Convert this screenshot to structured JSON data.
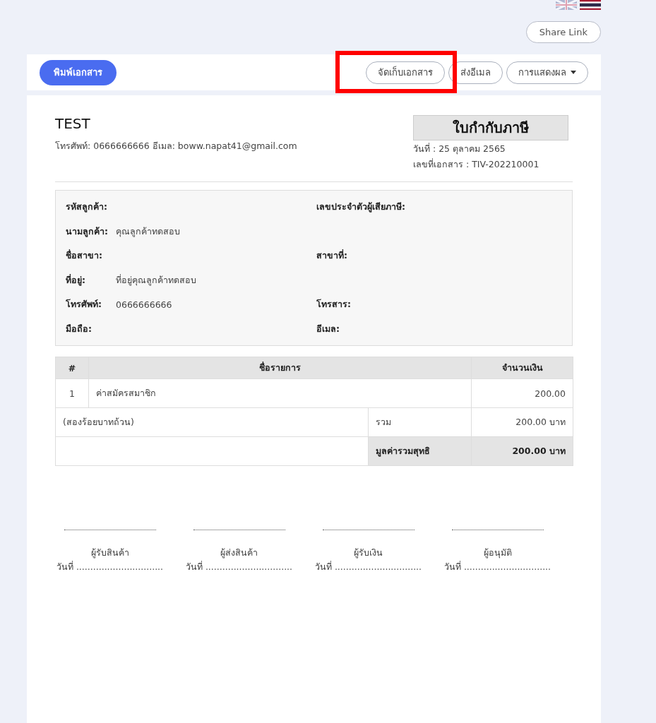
{
  "share_link": {
    "label": "Share Link"
  },
  "toolbar": {
    "print_button": "พิมพ์เอกสาร",
    "buttons": [
      {
        "label": "จัดเก็บเอกสาร"
      },
      {
        "label": "ส่งอีเมล"
      }
    ],
    "display_menu": "การแสดงผล",
    "highlight_box": true
  },
  "document": {
    "company": "TEST",
    "contact": "โทรศัพท์: 0666666666 อีเมล: boww.napat41@gmail.com",
    "title": "ใบกำกับภาษี",
    "date": "วันที่ : 25 ตุลาคม 2565",
    "doc_no": "เลขที่เอกสาร : TIV-202210001",
    "customer_rows": [
      [
        {
          "label": "รหัสลูกค้า:"
        },
        {
          "label": "เลขประจำตัวผู้เสียภาษี:"
        }
      ],
      [
        {
          "label": "นามลูกค้า:",
          "value": "คุณลูกค้าทดสอบ"
        }
      ],
      [
        {
          "label": "ชื่อสาขา:"
        },
        {
          "label": "สาขาที่:"
        }
      ],
      [
        {
          "label": "ที่อยู่:",
          "value": "ที่อยู่คุณลูกค้าทดสอบ"
        }
      ],
      [
        {
          "label": "โทรศัพท์:",
          "value": "0666666666"
        },
        {
          "label": "โทรสาร:"
        }
      ],
      [
        {
          "label": "มือถือ:"
        },
        {
          "label": "อีเมล:"
        }
      ]
    ],
    "table": {
      "columns": [
        "#",
        "ชื่อรายการ",
        "จำนวนเงิน"
      ],
      "rows": [
        {
          "no": "1",
          "name": "ค่าสมัครสมาชิก",
          "amount": "200.00"
        }
      ],
      "amount_in_words": "(สองร้อยบาทถ้วน)",
      "subtotal_label": "รวม",
      "subtotal": "200.00 บาท",
      "net_label": "มูลค่ารวมสุทธิ",
      "net": "200.00 บาท"
    },
    "signatures": [
      {
        "role": "ผู้รับสินค้า",
        "date": "วันที่ ..............................."
      },
      {
        "role": "ผู้ส่งสินค้า",
        "date": "วันที่ ..............................."
      },
      {
        "role": "ผู้รับเงิน",
        "date": "วันที่ ..............................."
      },
      {
        "role": "ผู้อนุมัติ",
        "date": "วันที่ ..............................."
      }
    ]
  }
}
